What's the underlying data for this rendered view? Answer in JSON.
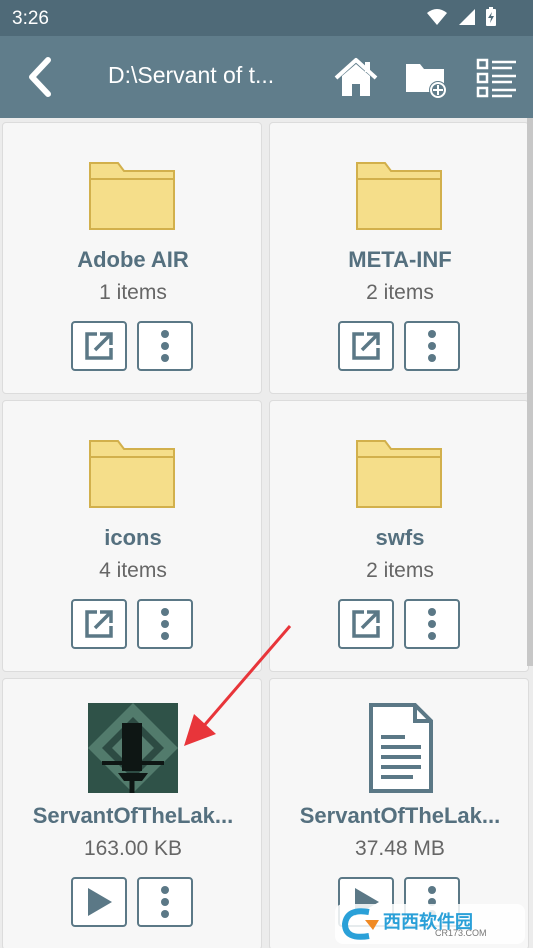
{
  "status_bar": {
    "time": "3:26"
  },
  "app_bar": {
    "path": "D:\\Servant of t...",
    "actions": [
      "home-icon",
      "new-folder-icon",
      "view-list-icon"
    ]
  },
  "items": [
    {
      "name": "Adobe AIR",
      "meta": "1 items",
      "kind": "folder",
      "primary_action": "open-external-icon"
    },
    {
      "name": "META-INF",
      "meta": "2 items",
      "kind": "folder",
      "primary_action": "open-external-icon"
    },
    {
      "name": "icons",
      "meta": "4 items",
      "kind": "folder",
      "primary_action": "open-external-icon"
    },
    {
      "name": "swfs",
      "meta": "2 items",
      "kind": "folder",
      "primary_action": "open-external-icon"
    },
    {
      "name": "ServantOfTheLak...",
      "meta": "163.00 KB",
      "kind": "image",
      "primary_action": "play-icon"
    },
    {
      "name": "ServantOfTheLak...",
      "meta": "37.48 MB",
      "kind": "document",
      "primary_action": "play-icon"
    }
  ],
  "watermark": {
    "text": "西西软件园",
    "sub": "CR173.COM"
  },
  "colors": {
    "app_bar": "#607d8b",
    "status_bar": "#4f6a78",
    "folder": "#f5de8a",
    "accent": "#5b7886",
    "arrow": "#e8353a"
  }
}
